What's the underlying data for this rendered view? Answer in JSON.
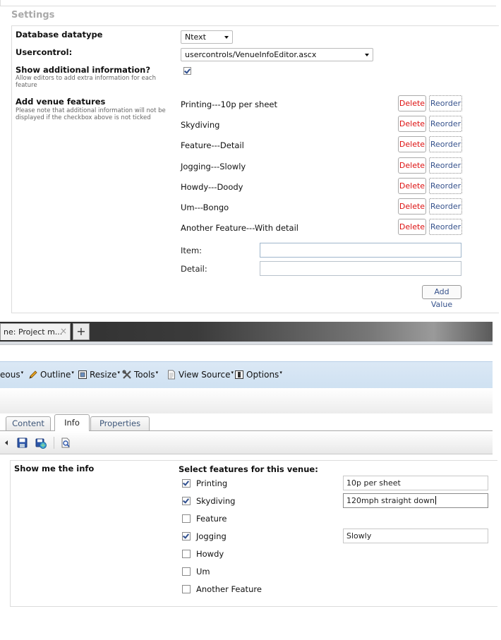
{
  "settings": {
    "heading": "Settings",
    "database_datatype": {
      "label": "Database datatype",
      "value": "Ntext"
    },
    "usercontrol": {
      "label": "Usercontrol:",
      "value": "usercontrols/VenueInfoEditor.ascx"
    },
    "show_info": {
      "label": "Show additional information?",
      "desc": "Allow editors to add extra information for each feature",
      "checked": true
    },
    "features": {
      "label": "Add venue features",
      "desc": "Please note that additional information will not be displayed if the checkbox above is not ticked",
      "items": [
        {
          "text": "Printing---10p per sheet"
        },
        {
          "text": "Skydiving"
        },
        {
          "text": "Feature---Detail"
        },
        {
          "text": "Jogging---Slowly"
        },
        {
          "text": "Howdy---Doody"
        },
        {
          "text": "Um---Bongo"
        },
        {
          "text": "Another Feature---With detail"
        }
      ],
      "delete_label": "Delete",
      "reorder_label": "Reorder",
      "item_label": "Item:",
      "detail_label": "Detail:",
      "add_value_label": "Add Value"
    }
  },
  "browser": {
    "tab_title": "ne: Project m...",
    "close_glyph": "×",
    "new_tab_glyph": "+"
  },
  "toolbar": {
    "misc": "eous",
    "outline": "Outline",
    "resize": "Resize",
    "tools": "Tools",
    "view_source": "View Source",
    "options": "Options"
  },
  "editor": {
    "tabs": [
      {
        "label": "Content",
        "active": false
      },
      {
        "label": "Info",
        "active": true
      },
      {
        "label": "Properties",
        "active": false
      }
    ],
    "icons": [
      "arrow-left-icon",
      "save-icon",
      "save-publish-icon",
      "preview-icon"
    ]
  },
  "info": {
    "label": "Show me the info",
    "heading": "Select features for this venue:",
    "features": [
      {
        "name": "Printing",
        "checked": true,
        "detail": "10p per sheet"
      },
      {
        "name": "Skydiving",
        "checked": true,
        "detail": "120mph straight down"
      },
      {
        "name": "Feature",
        "checked": false,
        "detail": null
      },
      {
        "name": "Jogging",
        "checked": true,
        "detail": "Slowly"
      },
      {
        "name": "Howdy",
        "checked": false,
        "detail": null
      },
      {
        "name": "Um",
        "checked": false,
        "detail": null
      },
      {
        "name": "Another Feature",
        "checked": false,
        "detail": null
      }
    ]
  }
}
